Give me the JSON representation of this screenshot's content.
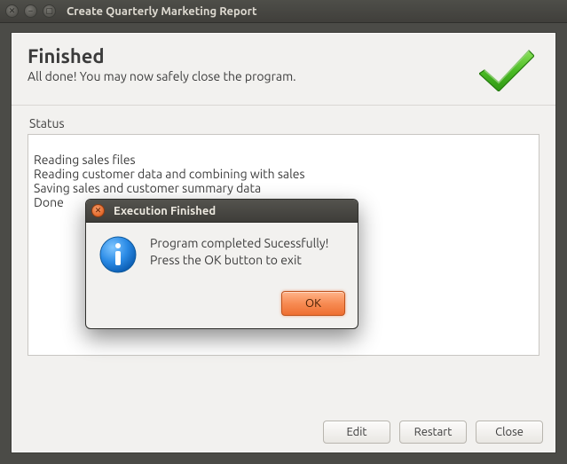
{
  "outer": {
    "title": "Create Quarterly Marketing Report"
  },
  "header": {
    "title": "Finished",
    "subtitle": "All done! You may now safely close the program."
  },
  "status": {
    "label": "Status",
    "lines": "Reading sales files\nReading customer data and combining with sales\nSaving sales and customer summary data\nDone"
  },
  "footer": {
    "edit": "Edit",
    "restart": "Restart",
    "close": "Close"
  },
  "dialog": {
    "title": "Execution Finished",
    "message": "Program completed Sucessfully!\nPress the OK button to exit",
    "ok": "OK"
  }
}
